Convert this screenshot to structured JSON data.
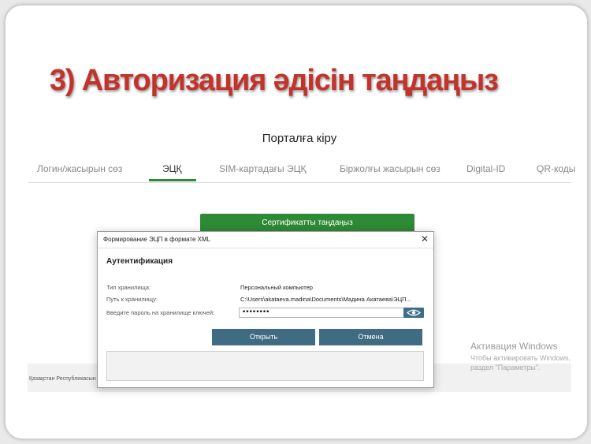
{
  "slide": {
    "title": "3) Авторизация әдісін таңдаңыз"
  },
  "portal": {
    "heading": "Порталға кіру",
    "tabs": [
      {
        "label": "Логин/жасырын сөз"
      },
      {
        "label": "ЭЦҚ"
      },
      {
        "label": "SIM-картадағы ЭЦҚ"
      },
      {
        "label": "Біржолғы жасырын сөз"
      },
      {
        "label": "Digital-ID"
      },
      {
        "label": "QR-коды"
      }
    ],
    "active_tab": "ЭЦҚ",
    "cert_button_label": "Сертификатты таңдаңыз",
    "footer_text": "Қазақстан Республикасын"
  },
  "dialog": {
    "title": "Формирование ЭЦП в формате XML",
    "heading": "Аутентификация",
    "storage_type_label": "Тип хранилища:",
    "storage_type_value": "Персональный компьютер",
    "storage_path_label": "Путь к хранилищу:",
    "storage_path_value": "C:\\Users\\akataeva.madina\\Documents\\Мадина Акатаева\\ЭЦП...",
    "password_label": "Введите пароль на хранилище ключей:",
    "password_value": "••••••••",
    "open_button": "Открыть",
    "cancel_button": "Отмена",
    "close_glyph": "✕"
  },
  "watermark": {
    "title": "Активация Windows",
    "line1": "Чтобы активировать Windows,",
    "line2": "раздел \"Параметры\"."
  },
  "colors": {
    "title_red": "#c2332b",
    "green": "#2d8a35",
    "dialog_button": "#3f6b83"
  }
}
